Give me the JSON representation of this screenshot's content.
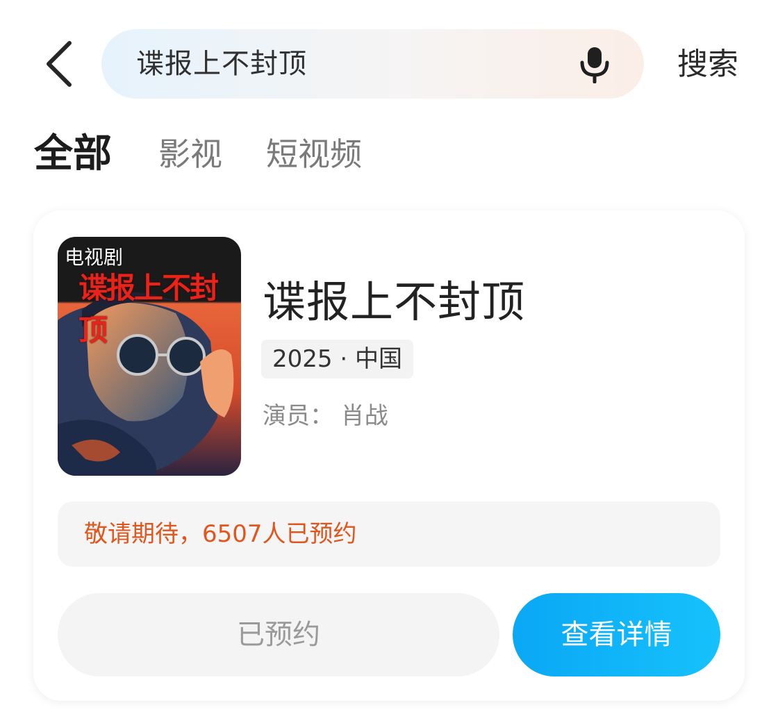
{
  "search": {
    "query": "谍报上不封顶",
    "submit_label": "搜索"
  },
  "tabs": [
    {
      "label": "全部",
      "active": true
    },
    {
      "label": "影视",
      "active": false
    },
    {
      "label": "短视频",
      "active": false
    }
  ],
  "result": {
    "poster_type": "电视剧",
    "poster_title": "谍报上不封顶",
    "title": "谍报上不封顶",
    "meta": "2025 · 中国",
    "cast": "演员：  肖战",
    "notice": "敬请期待，6507人已预约",
    "reserved_label": "已预约",
    "detail_label": "查看详情"
  },
  "colors": {
    "accent": "#16b4f8",
    "notice": "#e0561c"
  },
  "icons": {
    "back": "chevron-left-icon",
    "mic": "microphone-icon"
  }
}
